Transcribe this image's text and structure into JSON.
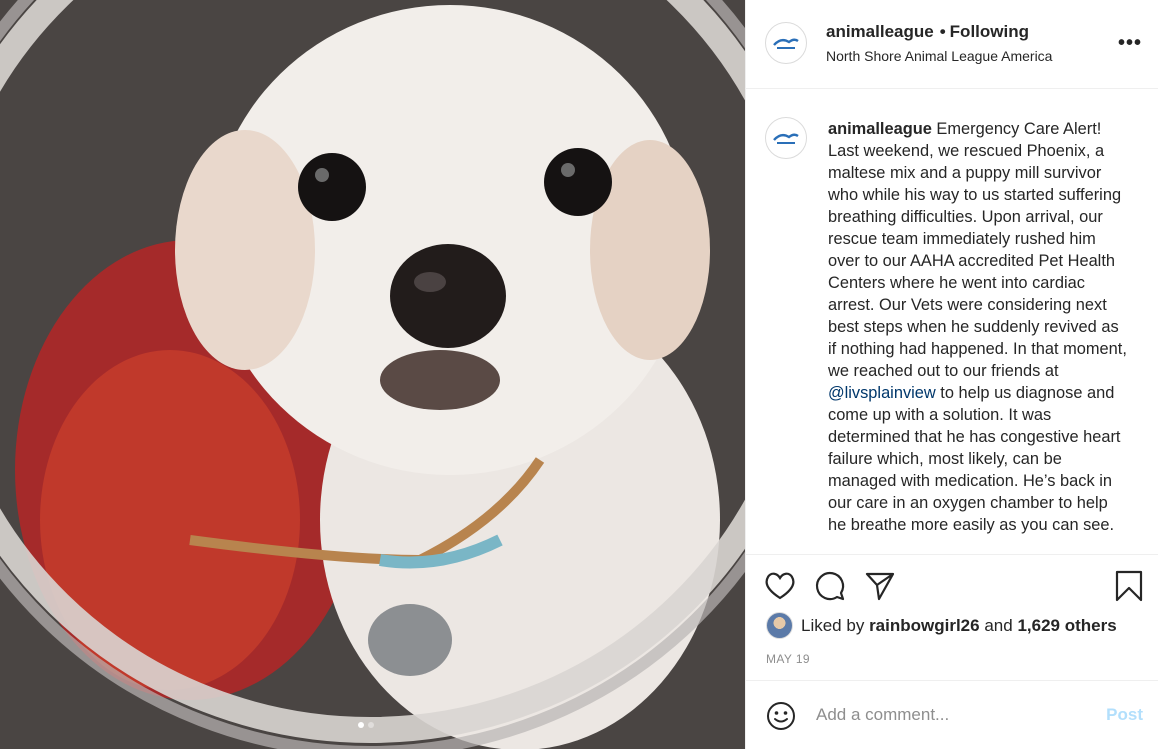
{
  "post": {
    "username": "animalleague",
    "follow_status": "Following",
    "location": "North Shore Animal League America",
    "more_glyph": "•••"
  },
  "caption": {
    "username": "animalleague",
    "text_part1": "Emergency Care Alert! Last weekend, we rescued Phoenix, a maltese mix and a puppy mill survivor who while his way to us started suffering breathing difficulties. Upon arrival, our rescue team immediately rushed him over to our AAHA accredited Pet Health Centers where he went into cardiac arrest. Our Vets were considering next best steps when he suddenly revived as if nothing had happened. In that moment, we reached out to our friends at",
    "mention": "@livsplainview",
    "text_part2": "to help us diagnose and come up with a solution. It was determined that he has congestive heart failure which, most likely, can be managed with medication. He’s back in our care in an oxygen chamber to help he breathe more easily as you can see."
  },
  "likes": {
    "prefix": "Liked by",
    "user": "rainbowgirl26",
    "and": "and",
    "count": "1,629 others"
  },
  "date": "MAY 19",
  "comment": {
    "placeholder": "Add a comment...",
    "post_label": "Post"
  },
  "carousel": {
    "current": 1,
    "total": 2
  },
  "icons": {
    "like": "heart-icon",
    "comment": "comment-icon",
    "share": "share-icon",
    "save": "bookmark-icon",
    "emoji": "emoji-icon",
    "more": "more-icon"
  },
  "colors": {
    "text": "#262626",
    "muted": "#8e8e8e",
    "mention": "#00376b",
    "post_disabled": "#b2dffc",
    "border": "#efefef"
  }
}
